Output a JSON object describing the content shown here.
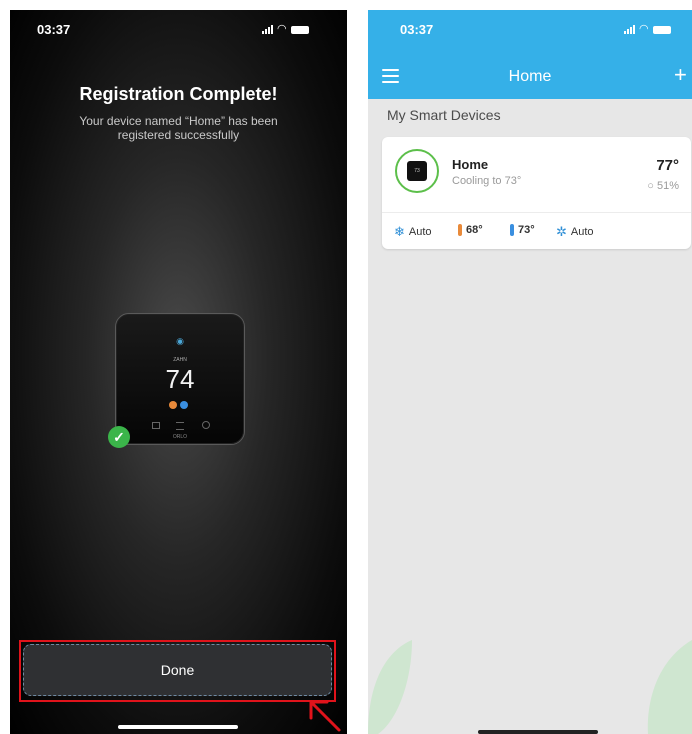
{
  "left_screen": {
    "status_time": "03:37",
    "title": "Registration Complete!",
    "subtitle": "Your device named “Home” has been registered successfully",
    "device_preview": {
      "temperature": "74",
      "mode_label": "ZAHN",
      "brand": "ORLO"
    },
    "done_label": "Done"
  },
  "right_screen": {
    "status_time": "03:37",
    "nav_title": "Home",
    "section_title": "My Smart Devices",
    "device_card": {
      "name": "Home",
      "status": "Cooling to 73°",
      "temperature": "77°",
      "humidity": "51%",
      "mini_temp": "73",
      "controls": {
        "mode": "Auto",
        "heat_setpoint": "68°",
        "cool_setpoint": "73°",
        "fan": "Auto"
      }
    }
  },
  "icons": {
    "menu": "hamburger-icon",
    "add": "plus-icon",
    "mode": "snowflake-sun-icon",
    "heat": "thermometer-heat-icon",
    "cool": "thermometer-cool-icon",
    "fan": "fan-icon",
    "humidity": "droplet-icon",
    "check": "check-icon"
  },
  "colors": {
    "header_blue": "#35b0e8",
    "accent_green": "#5cbf4a",
    "check_green": "#3bb54a",
    "highlight_red": "#e0131b",
    "heat_orange": "#e98a3a",
    "cool_blue": "#3a8fe0"
  }
}
